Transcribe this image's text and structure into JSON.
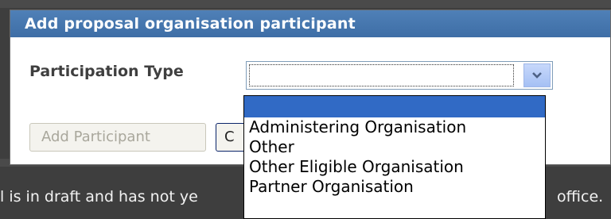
{
  "dialog": {
    "title": "Add proposal organisation participant",
    "participation_type_label": "Participation Type",
    "participation_type_value": "",
    "add_participant_label": "Add Participant",
    "cancel_label_partial": "C"
  },
  "dropdown": {
    "options": [
      "",
      "Administering Organisation",
      "Other",
      "Other Eligible Organisation",
      "Partner Organisation"
    ],
    "selected_index": 0
  },
  "background": {
    "status_text_left": "l is in draft and has not ye",
    "status_text_right": "office."
  },
  "colors": {
    "title_bar": "#4474ad",
    "selection": "#316ac5",
    "dim_overlay": "#3e3e3e"
  }
}
